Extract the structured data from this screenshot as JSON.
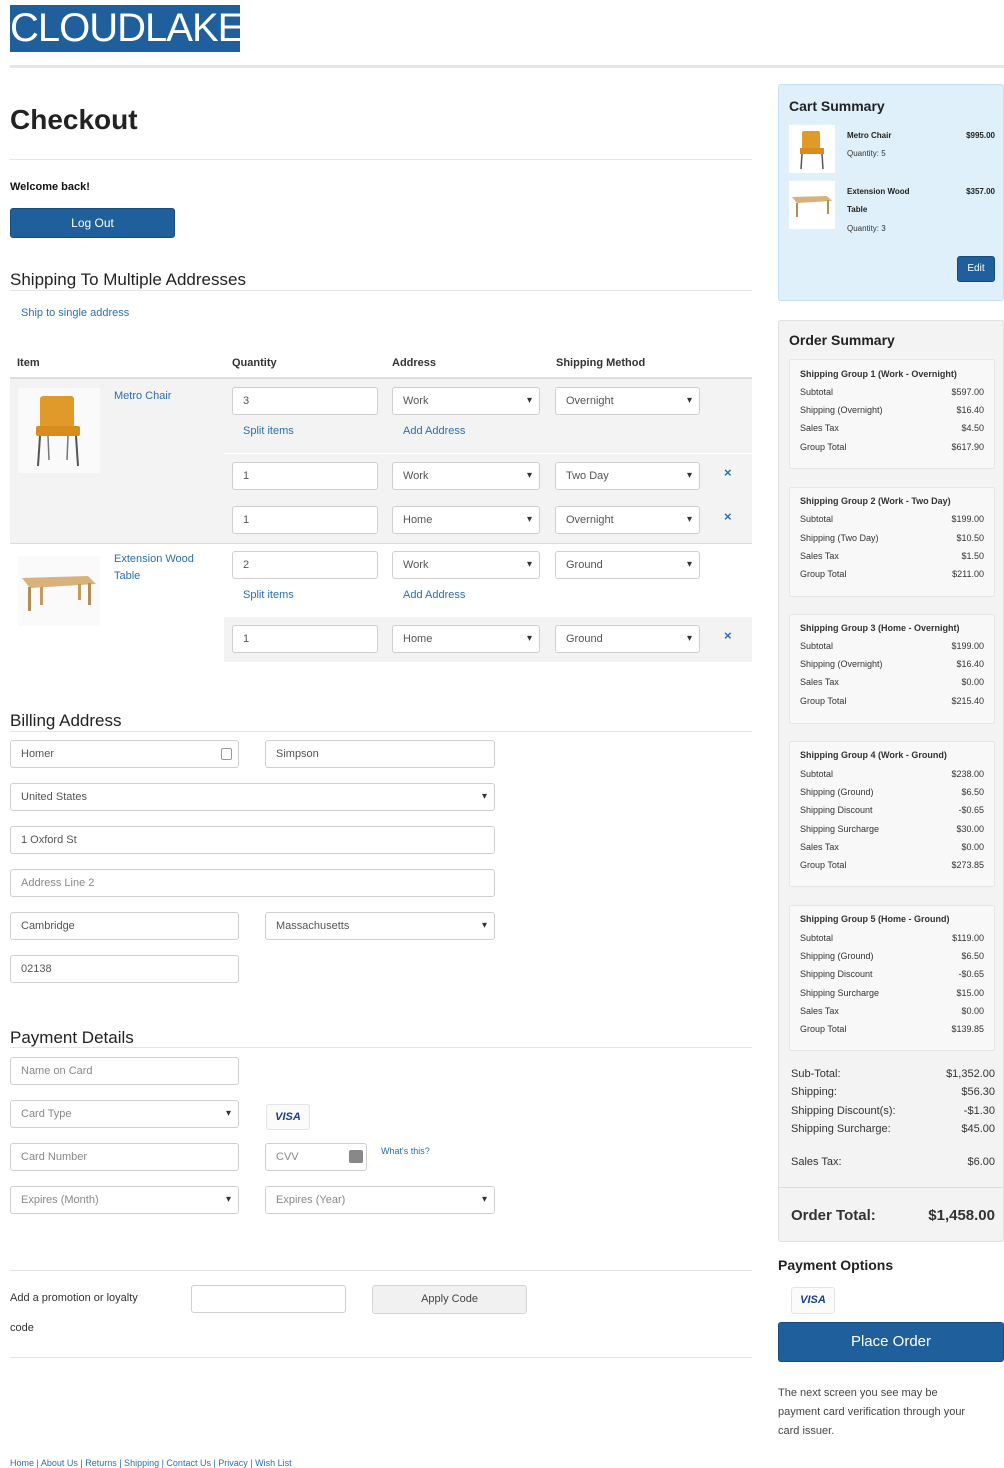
{
  "brand": "CLOUDLAKE",
  "page_title": "Checkout",
  "welcome": "Welcome back!",
  "logout_label": "Log Out",
  "shipping": {
    "title": "Shipping To Multiple Addresses",
    "single_link": "Ship to single address",
    "headers": {
      "item": "Item",
      "quantity": "Quantity",
      "address": "Address",
      "method": "Shipping Method"
    },
    "split_label": "Split items",
    "add_address_label": "Add Address",
    "items": [
      {
        "name": "Metro Chair",
        "rows": [
          {
            "qty": "3",
            "address": "Work",
            "method": "Overnight"
          },
          {
            "qty": "1",
            "address": "Work",
            "method": "Two Day"
          },
          {
            "qty": "1",
            "address": "Home",
            "method": "Overnight"
          }
        ]
      },
      {
        "name": "Extension Wood Table",
        "rows": [
          {
            "qty": "2",
            "address": "Work",
            "method": "Ground"
          },
          {
            "qty": "1",
            "address": "Home",
            "method": "Ground"
          }
        ]
      }
    ],
    "remove_glyph": "×"
  },
  "billing": {
    "title": "Billing Address",
    "first_name": "Homer",
    "last_name": "Simpson",
    "country": "United States",
    "address1": "1 Oxford St",
    "address2_placeholder": "Address Line 2",
    "city": "Cambridge",
    "state": "Massachusetts",
    "zip": "02138"
  },
  "payment": {
    "title": "Payment Details",
    "name_placeholder": "Name on Card",
    "card_type_placeholder": "Card Type",
    "visa": "VISA",
    "card_number_placeholder": "Card Number",
    "cvv_placeholder": "CVV",
    "whats_this": "What's this?",
    "exp_month": "Expires (Month)",
    "exp_year": "Expires (Year)"
  },
  "promo": {
    "label_line1": "Add a promotion or loyalty",
    "label_line2": "code",
    "apply_label": "Apply Code"
  },
  "cart_summary": {
    "title": "Cart Summary",
    "items": [
      {
        "name": "Metro Chair",
        "qty": "Quantity: 5",
        "price": "$995.00"
      },
      {
        "name_line1": "Extension Wood",
        "name_line2": "Table",
        "qty": "Quantity: 3",
        "price": "$357.00"
      }
    ],
    "edit_label": "Edit"
  },
  "order_summary": {
    "title": "Order Summary",
    "groups": [
      {
        "title": "Shipping Group 1 (Work - Overnight)",
        "rows": [
          [
            "Subtotal",
            "$597.00"
          ],
          [
            "Shipping (Overnight)",
            "$16.40"
          ],
          [
            "Sales Tax",
            "$4.50"
          ],
          [
            "Group Total",
            "$617.90"
          ]
        ]
      },
      {
        "title": "Shipping Group 2 (Work - Two Day)",
        "rows": [
          [
            "Subtotal",
            "$199.00"
          ],
          [
            "Shipping (Two Day)",
            "$10.50"
          ],
          [
            "Sales Tax",
            "$1.50"
          ],
          [
            "Group Total",
            "$211.00"
          ]
        ]
      },
      {
        "title": "Shipping Group 3 (Home - Overnight)",
        "rows": [
          [
            "Subtotal",
            "$199.00"
          ],
          [
            "Shipping (Overnight)",
            "$16.40"
          ],
          [
            "Sales Tax",
            "$0.00"
          ],
          [
            "Group Total",
            "$215.40"
          ]
        ]
      },
      {
        "title": "Shipping Group 4 (Work - Ground)",
        "rows": [
          [
            "Subtotal",
            "$238.00"
          ],
          [
            "Shipping (Ground)",
            "$6.50"
          ],
          [
            "Shipping Discount",
            "-$0.65"
          ],
          [
            "Shipping Surcharge",
            "$30.00"
          ],
          [
            "Sales Tax",
            "$0.00"
          ],
          [
            "Group Total",
            "$273.85"
          ]
        ]
      },
      {
        "title": "Shipping Group 5 (Home - Ground)",
        "rows": [
          [
            "Subtotal",
            "$119.00"
          ],
          [
            "Shipping (Ground)",
            "$6.50"
          ],
          [
            "Shipping Discount",
            "-$0.65"
          ],
          [
            "Shipping Surcharge",
            "$15.00"
          ],
          [
            "Sales Tax",
            "$0.00"
          ],
          [
            "Group Total",
            "$139.85"
          ]
        ]
      }
    ],
    "totals": [
      [
        "Sub-Total:",
        "$1,352.00"
      ],
      [
        "Shipping:",
        "$56.30"
      ],
      [
        "Shipping Discount(s):",
        "-$1.30"
      ],
      [
        "Shipping Surcharge:",
        "$45.00"
      ]
    ],
    "sales_tax": [
      "Sales Tax:",
      "$6.00"
    ],
    "order_total_label": "Order Total:",
    "order_total_value": "$1,458.00"
  },
  "payment_options": {
    "title": "Payment Options",
    "visa": "VISA",
    "place_order": "Place Order",
    "note_line1": "The next screen you see may be",
    "note_line2": "payment card verification through your",
    "note_line3": "card issuer."
  },
  "footer": "Home | About Us | Returns | Shipping | Contact Us | Privacy | Wish List",
  "colors": {
    "brand": "#1f5f9c",
    "link": "#2a6fb0",
    "cart_bg": "#dff0fb",
    "panel_bg": "#f3f3f3"
  }
}
